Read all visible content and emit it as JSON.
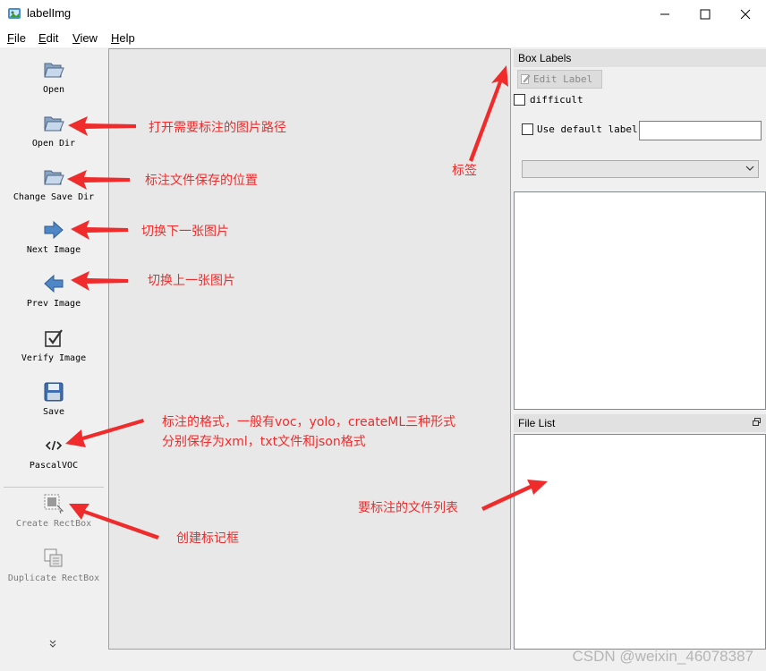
{
  "window": {
    "title": "labelImg",
    "controls": [
      "minimize",
      "maximize",
      "close"
    ]
  },
  "menu": {
    "items": [
      {
        "key": "F",
        "rest": "ile"
      },
      {
        "key": "E",
        "rest": "dit"
      },
      {
        "key": "V",
        "rest": "iew"
      },
      {
        "key": "H",
        "rest": "elp"
      }
    ]
  },
  "toolbar": {
    "items": [
      {
        "label": "Open",
        "icon": "folder-open-icon",
        "enabled": true
      },
      {
        "label": "Open Dir",
        "icon": "folder-open-icon",
        "enabled": true
      },
      {
        "label": "Change Save Dir",
        "icon": "folder-open-icon",
        "enabled": true
      },
      {
        "label": "Next Image",
        "icon": "arrow-right-icon",
        "enabled": true
      },
      {
        "label": "Prev Image",
        "icon": "arrow-left-icon",
        "enabled": true
      },
      {
        "label": "Verify Image",
        "icon": "checkbox-check-icon",
        "enabled": true
      },
      {
        "label": "Save",
        "icon": "floppy-disk-icon",
        "enabled": true
      },
      {
        "label": "PascalVOC",
        "icon": "code-tag-icon",
        "enabled": true
      },
      {
        "label": "Create RectBox",
        "icon": "create-rect-icon",
        "enabled": false
      },
      {
        "label": "Duplicate RectBox",
        "icon": "duplicate-rect-icon",
        "enabled": false
      }
    ],
    "more_icon": "chevron-double-down-icon"
  },
  "box_labels": {
    "title": "Box Labels",
    "edit_label": "Edit Label",
    "difficult": "difficult",
    "use_default_label": "Use default label",
    "default_label_value": ""
  },
  "file_list": {
    "title": "File List"
  },
  "annotations": {
    "open_dir": "打开需要标注的图片路径",
    "change_save_dir": "标注文件保存的位置",
    "next_image": "切换下一张图片",
    "prev_image": "切换上一张图片",
    "format_line1": "标注的格式，一般有voc，yolo，createML三种形式",
    "format_line2": "分别保存为xml，txt文件和json格式",
    "create_rectbox": "创建标记框",
    "label": "标签",
    "file_list": "要标注的文件列表"
  },
  "watermark": "CSDN @weixin_46078387",
  "colors": {
    "annotation": "#f02b2b",
    "canvas": "#e8e8e8",
    "chrome": "#f0f0f0"
  }
}
